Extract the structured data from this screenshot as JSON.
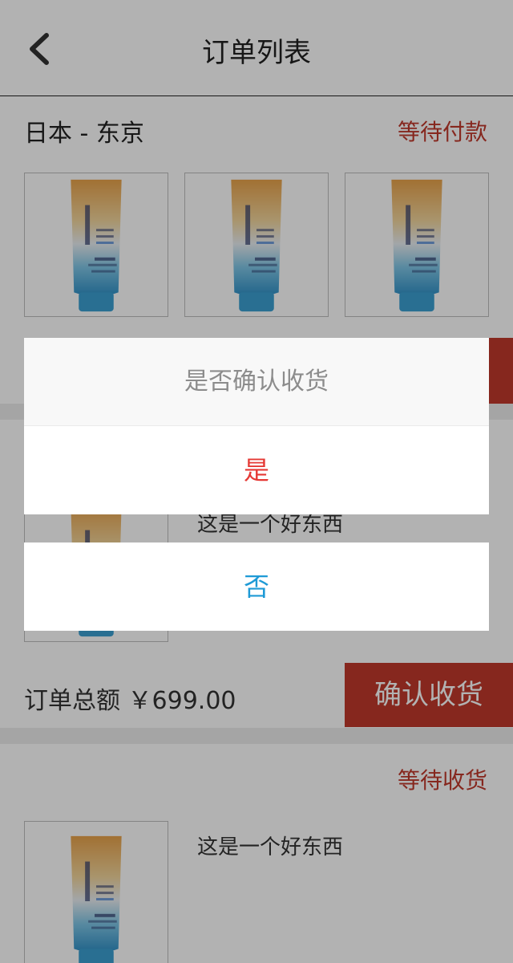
{
  "header": {
    "title": "订单列表",
    "back_icon": "chevron-left-icon"
  },
  "orders": [
    {
      "location": "日本  - 东京",
      "status": "等待付款",
      "products": [
        "product-tube",
        "product-tube",
        "product-tube"
      ]
    },
    {
      "description": "这是一个好东西",
      "total": "订单总额  ￥699.00",
      "confirm_label": "确认收货"
    },
    {
      "status": "等待收货",
      "description": "这是一个好东西"
    }
  ],
  "dialog": {
    "title": "是否确认收货",
    "yes_label": "是",
    "no_label": "否"
  },
  "colors": {
    "accent_red": "#c0392b",
    "yes_red": "#e53935",
    "no_blue": "#1e9ad6",
    "overlay": "rgba(0,0,0,0.3)"
  }
}
